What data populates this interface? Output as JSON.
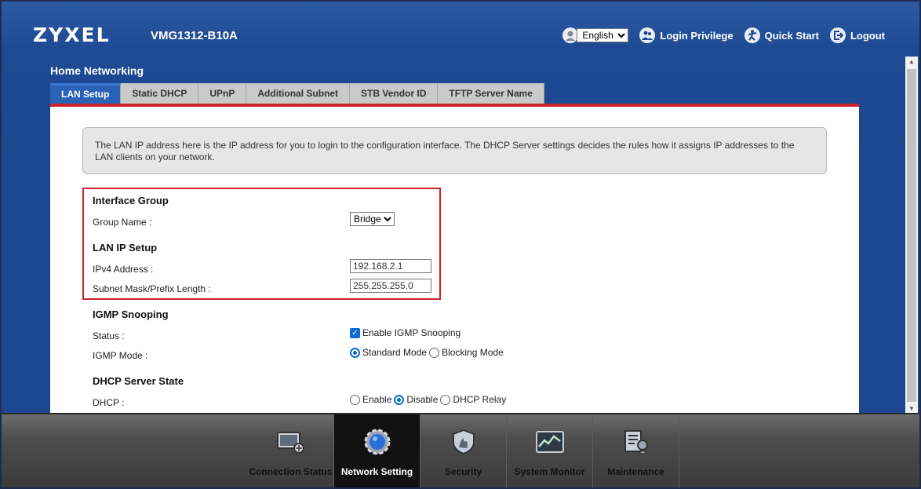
{
  "header": {
    "brand": "ZYXEL",
    "model": "VMG1312-B10A",
    "language": "English",
    "login_privilege": "Login Privilege",
    "quick_start": "Quick Start",
    "logout": "Logout"
  },
  "page": {
    "section_title": "Home Networking",
    "tabs": [
      {
        "label": "LAN Setup",
        "active": true
      },
      {
        "label": "Static DHCP"
      },
      {
        "label": "UPnP"
      },
      {
        "label": "Additional Subnet"
      },
      {
        "label": "STB Vendor ID"
      },
      {
        "label": "TFTP Server Name"
      }
    ],
    "info_text": "The LAN IP address here is the IP address for you to login to the configuration interface. The DHCP Server settings decides the rules how it assigns IP addresses to the LAN clients on your network."
  },
  "form": {
    "interface_group": {
      "title": "Interface Group",
      "group_name_label": "Group Name :",
      "group_name_value": "Bridge"
    },
    "lan_ip": {
      "title": "LAN IP Setup",
      "ipv4_label": "IPv4 Address :",
      "ipv4_value": "192.168.2.1",
      "subnet_label": "Subnet Mask/Prefix Length :",
      "subnet_value": "255.255.255.0"
    },
    "igmp": {
      "title": "IGMP Snooping",
      "status_label": "Status :",
      "status_checkbox_label": "Enable IGMP Snooping",
      "mode_label": "IGMP Mode :",
      "mode_standard": "Standard Mode",
      "mode_blocking": "Blocking Mode"
    },
    "dhcp": {
      "title": "DHCP Server State",
      "dhcp_label": "DHCP :",
      "enable": "Enable",
      "disable": "Disable",
      "relay": "DHCP Relay"
    }
  },
  "footer_nav": [
    {
      "label": "Connection Status",
      "icon": "connection-status-icon"
    },
    {
      "label": "Network Setting",
      "icon": "network-setting-icon",
      "active": true
    },
    {
      "label": "Security",
      "icon": "security-shield-icon"
    },
    {
      "label": "System Monitor",
      "icon": "system-monitor-icon"
    },
    {
      "label": "Maintenance",
      "icon": "maintenance-icon"
    }
  ],
  "colors": {
    "header_blue": "#1c4790",
    "accent_red": "#d0202a",
    "active_tab": "#2a63b6"
  }
}
